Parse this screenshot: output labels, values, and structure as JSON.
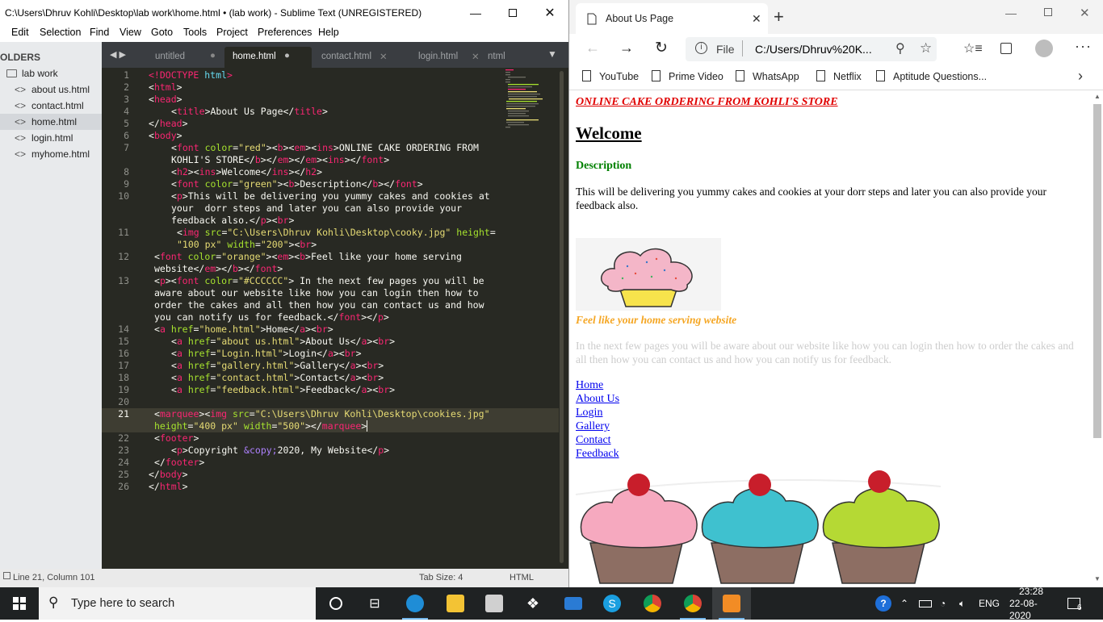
{
  "sublime": {
    "title": "C:\\Users\\Dhruv Kohli\\Desktop\\lab work\\home.html • (lab work) - Sublime Text (UNREGISTERED)",
    "menu": [
      "Edit",
      "Selection",
      "Find",
      "View",
      "Goto",
      "Tools",
      "Project",
      "Preferences",
      "Help"
    ],
    "sidebar": {
      "header": "OLDERS",
      "folder": "lab work",
      "files": [
        "about us.html",
        "contact.html",
        "home.html",
        "login.html",
        "myhome.html"
      ],
      "selected": "home.html"
    },
    "tabs": [
      "untitled",
      "home.html",
      "contact.html",
      "login.html",
      "ntml"
    ],
    "active_tab": "home.html",
    "line_numbers": [
      "1",
      "2",
      "3",
      "4",
      "5",
      "6",
      "7",
      "8",
      "9",
      "10",
      "11",
      "12",
      "13",
      "14",
      "15",
      "16",
      "17",
      "18",
      "19",
      "20",
      "21",
      "22",
      "23",
      "24",
      "25",
      "26"
    ],
    "current_line": "21",
    "status": {
      "position": "Line 21, Column 101",
      "tab_size": "Tab Size: 4",
      "syntax": "HTML"
    }
  },
  "browser": {
    "tab_title": "About Us Page",
    "url_prefix": "File",
    "url": "C:/Users/Dhruv%20K...",
    "bookmarks": [
      "YouTube",
      "Prime Video",
      "WhatsApp",
      "Netflix",
      "Aptitude Questions..."
    ],
    "page": {
      "heading_red": "ONLINE CAKE ORDERING FROM KOHLI'S STORE",
      "welcome": "Welcome",
      "description": "Description",
      "paragraph": "This will be delivering you yummy cakes and cookies at your dorr steps and later you can also provide your feedback also.",
      "orange": "Feel like your home serving website",
      "grey": "In the next few pages you will be aware about our website like how you can login then how to order the cakes and all then how you can contact us and how you can notify us for feedback.",
      "links": [
        "Home",
        "About Us",
        "Login",
        "Gallery",
        "Contact",
        "Feedback"
      ]
    }
  },
  "taskbar": {
    "search_placeholder": "Type here to search",
    "language": "ENG",
    "time": "23:28",
    "date": "22-08-2020",
    "notifications": "6"
  },
  "colors": {
    "editor_bg": "#282923",
    "tag": "#f92672",
    "attr": "#a6e22e",
    "string": "#e6db74",
    "entity": "#ae81ff",
    "red": "#e00000",
    "green": "#008000",
    "orange": "#f5a623",
    "grey": "#cccccc",
    "link": "#0000ee"
  }
}
